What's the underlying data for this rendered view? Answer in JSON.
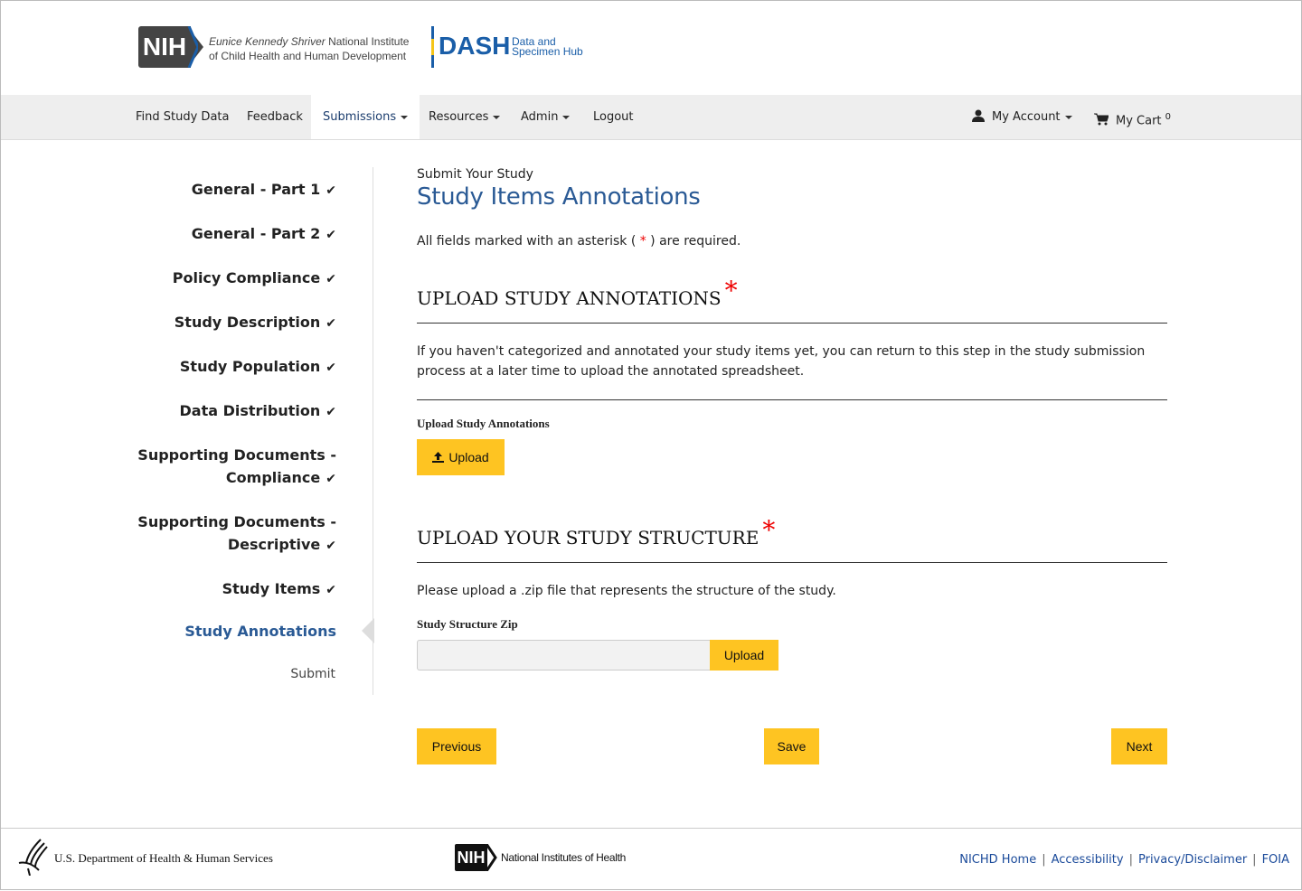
{
  "header": {
    "logo_nih": "NIH",
    "institute_italic": "Eunice Kennedy Shriver",
    "institute_line1_rest": "National Institute",
    "institute_line2": "of Child Health and Human Development",
    "dash": "DASH",
    "dash_sub1": "Data and",
    "dash_sub2": "Specimen Hub"
  },
  "nav": {
    "items": [
      "Find Study Data",
      "Feedback",
      "Submissions",
      "Resources",
      "Admin",
      "Logout"
    ],
    "my_account": "My Account",
    "my_cart": "My Cart",
    "cart_count": "0"
  },
  "sidebar": {
    "items": [
      "General - Part 1",
      "General - Part 2",
      "Policy Compliance",
      "Study Description",
      "Study Population",
      "Data Distribution",
      "Supporting Documents -",
      "Compliance",
      "Supporting Documents -",
      "Descriptive",
      "Study Items",
      "Study Annotations",
      "Submit"
    ],
    "check": "✔"
  },
  "main": {
    "subtitle": "Submit Your Study",
    "title": "Study Items Annotations",
    "req_before": "All fields marked with an asterisk ( ",
    "req_star": "*",
    "req_after": " ) are required.",
    "section1": {
      "heading": "UPLOAD STUDY ANNOTATIONS",
      "text": "If you haven't categorized and annotated your study items yet, you can return to this step in the study submission process at a later time to upload the annotated spreadsheet.",
      "label": "Upload Study Annotations",
      "button": "Upload"
    },
    "section2": {
      "heading": "UPLOAD YOUR STUDY STRUCTURE",
      "text": "Please upload a .zip file that represents the structure of the study.",
      "label": "Study Structure Zip",
      "input_value": "",
      "button": "Upload"
    },
    "buttons": {
      "previous": "Previous",
      "save": "Save",
      "next": "Next"
    }
  },
  "footer": {
    "hhs": "U.S. Department of Health & Human Services",
    "nih_logo": "NIH",
    "nih": "National Institutes of Health",
    "links": [
      "NICHD Home",
      "Accessibility",
      "Privacy/Disclaimer",
      "FOIA"
    ]
  },
  "colors": {
    "accent": "#fec422",
    "brand": "#2a5a95"
  }
}
